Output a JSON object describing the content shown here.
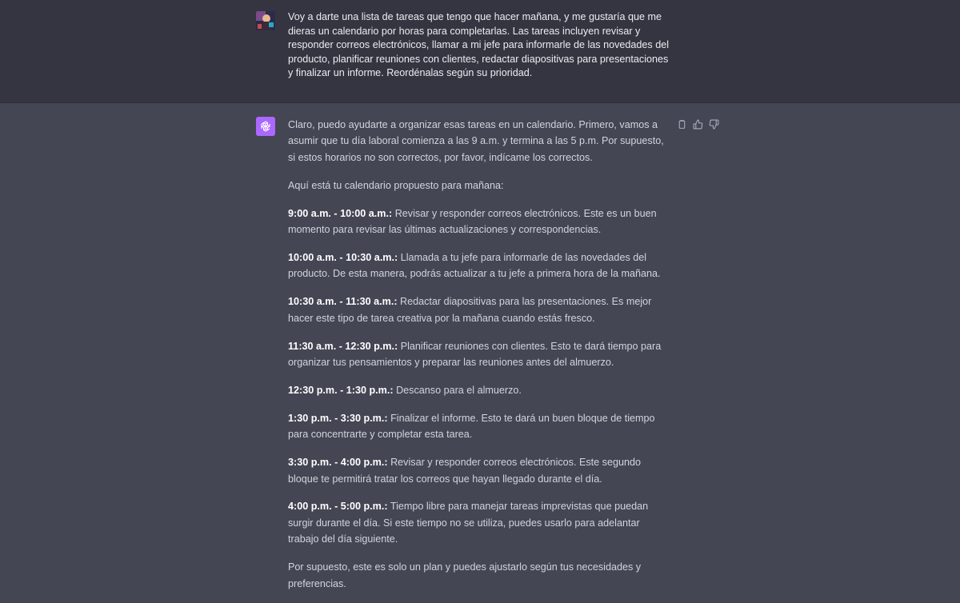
{
  "user_message": {
    "avatar": "user-avatar-image",
    "text": "Voy a darte una lista de tareas que tengo que hacer mañana, y me gustaría que me dieras un calendario por horas para completarlas. Las tareas incluyen revisar y responder correos electrónicos, llamar a mi jefe para informarle de las novedades del producto, planificar reuniones con clientes, redactar diapositivas para presentaciones y finalizar un informe. Reordénalas según su prioridad."
  },
  "assistant_message": {
    "avatar": "openai-logo-icon",
    "intro": "Claro, puedo ayudarte a organizar esas tareas en un calendario. Primero, vamos a asumir que tu día laboral comienza a las 9 a.m. y termina a las 5 p.m. Por supuesto, si estos horarios no son correctos, por favor, indícame los correctos.",
    "lead": "Aquí está tu calendario propuesto para mañana:",
    "schedule": [
      {
        "time": "9:00 a.m. - 10:00 a.m.:",
        "desc": " Revisar y responder correos electrónicos. Este es un buen momento para revisar las últimas actualizaciones y correspondencias."
      },
      {
        "time": "10:00 a.m. - 10:30 a.m.:",
        "desc": " Llamada a tu jefe para informarle de las novedades del producto. De esta manera, podrás actualizar a tu jefe a primera hora de la mañana."
      },
      {
        "time": "10:30 a.m. - 11:30 a.m.:",
        "desc": " Redactar diapositivas para las presentaciones. Es mejor hacer este tipo de tarea creativa por la mañana cuando estás fresco."
      },
      {
        "time": "11:30 a.m. - 12:30 p.m.:",
        "desc": " Planificar reuniones con clientes. Esto te dará tiempo para organizar tus pensamientos y preparar las reuniones antes del almuerzo."
      },
      {
        "time": "12:30 p.m. - 1:30 p.m.:",
        "desc": " Descanso para el almuerzo."
      },
      {
        "time": "1:30 p.m. - 3:30 p.m.:",
        "desc": " Finalizar el informe. Esto te dará un buen bloque de tiempo para concentrarte y completar esta tarea."
      },
      {
        "time": "3:30 p.m. - 4:00 p.m.:",
        "desc": " Revisar y responder correos electrónicos. Este segundo bloque te permitirá tratar los correos que hayan llegado durante el día."
      },
      {
        "time": "4:00 p.m. - 5:00 p.m.:",
        "desc": " Tiempo libre para manejar tareas imprevistas que puedan surgir durante el día. Si este tiempo no se utiliza, puedes usarlo para adelantar trabajo del día siguiente."
      }
    ],
    "closing": "Por supuesto, este es solo un plan y puedes ajustarlo según tus necesidades y preferencias."
  },
  "actions": {
    "copy": "copy-icon",
    "like": "thumbs-up-icon",
    "dislike": "thumbs-down-icon"
  }
}
